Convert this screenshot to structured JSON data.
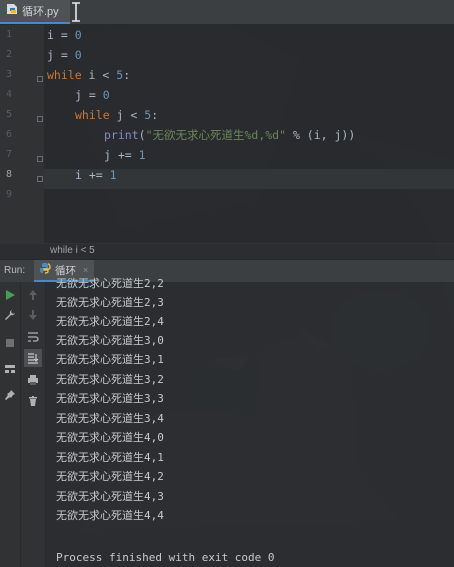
{
  "editor_tab": {
    "filename": "循环.py"
  },
  "gutter": {
    "line_numbers": [
      "1",
      "2",
      "3",
      "4",
      "5",
      "6",
      "7",
      "8",
      "9"
    ]
  },
  "code": {
    "l1_a": "i",
    "l1_b": " = ",
    "l1_c": "0",
    "l2_a": "j",
    "l2_b": " = ",
    "l2_c": "0",
    "l3_kw": "while",
    "l3_b": " i < ",
    "l3_c": "5",
    "l3_d": ":",
    "l4_a": "j",
    "l4_b": " = ",
    "l4_c": "0",
    "l5_kw": "while",
    "l5_b": " j < ",
    "l5_c": "5",
    "l5_d": ":",
    "l6_fn": "print",
    "l6_b": "(",
    "l6_str": "\"无欲无求心死道生%d,%d\"",
    "l6_c": " % (i, j))",
    "l7_a": "j += ",
    "l7_c": "1",
    "l8_a": "i += ",
    "l8_c": "1"
  },
  "breadcrumb": {
    "text": "while i < 5"
  },
  "run_bar": {
    "label": "Run:",
    "tab_label": "循环",
    "close": "×"
  },
  "output": {
    "lines": [
      "无欲无求心死道生2,2",
      "无欲无求心死道生2,3",
      "无欲无求心死道生2,4",
      "无欲无求心死道生3,0",
      "无欲无求心死道生3,1",
      "无欲无求心死道生3,2",
      "无欲无求心死道生3,3",
      "无欲无求心死道生3,4",
      "无欲无求心死道生4,0",
      "无欲无求心死道生4,1",
      "无欲无求心死道生4,2",
      "无欲无求心死道生4,3",
      "无欲无求心死道生4,4"
    ],
    "exit_message": "Process finished with exit code 0"
  },
  "icons": {
    "rerun": "play-icon",
    "wrench": "wrench-icon",
    "stop": "stop-icon",
    "layout": "layout-icon",
    "pin": "pin-icon",
    "up": "arrow-up-icon",
    "down": "arrow-down-icon",
    "wrap": "soft-wrap-icon",
    "sort": "scroll-to-end-icon",
    "print": "print-icon",
    "trash": "trash-icon"
  },
  "colors": {
    "keyword": "#cc7832",
    "number": "#6897bb",
    "string": "#6a8759",
    "builtin": "#8888c6",
    "accent": "#4a88c7",
    "run_green": "#499c54"
  }
}
